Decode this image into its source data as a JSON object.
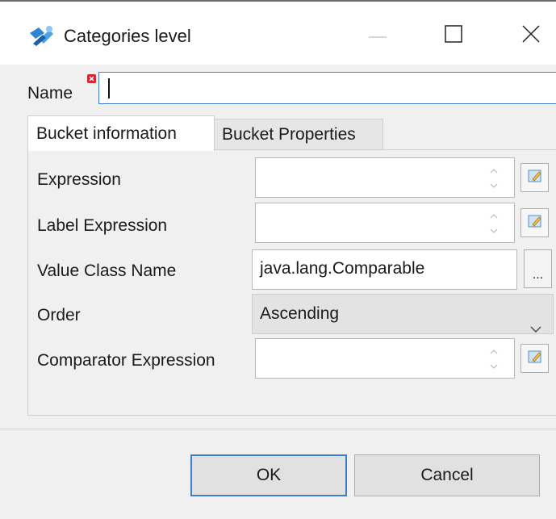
{
  "window": {
    "title": "Categories level",
    "app_icon": "tool-icon",
    "controls": [
      "minimize-icon",
      "maximize-icon",
      "close-icon"
    ]
  },
  "name_field": {
    "label": "Name",
    "value": "",
    "required_marker": "error-badge-icon"
  },
  "tabs": [
    {
      "label": "Bucket information",
      "active": true
    },
    {
      "label": "Bucket Properties",
      "active": false
    }
  ],
  "form": {
    "expression": {
      "label": "Expression",
      "value": ""
    },
    "label_expression": {
      "label": "Label Expression",
      "value": ""
    },
    "value_class_name": {
      "label": "Value Class Name",
      "value": "java.lang.Comparable",
      "browse_label": "..."
    },
    "order": {
      "label": "Order",
      "selected": "Ascending"
    },
    "comparator_expression": {
      "label": "Comparator Expression",
      "value": ""
    }
  },
  "buttons": {
    "ok": "OK",
    "cancel": "Cancel"
  },
  "colors": {
    "focus_border": "#3c7fd1",
    "window_bg": "#f0f0f0"
  }
}
